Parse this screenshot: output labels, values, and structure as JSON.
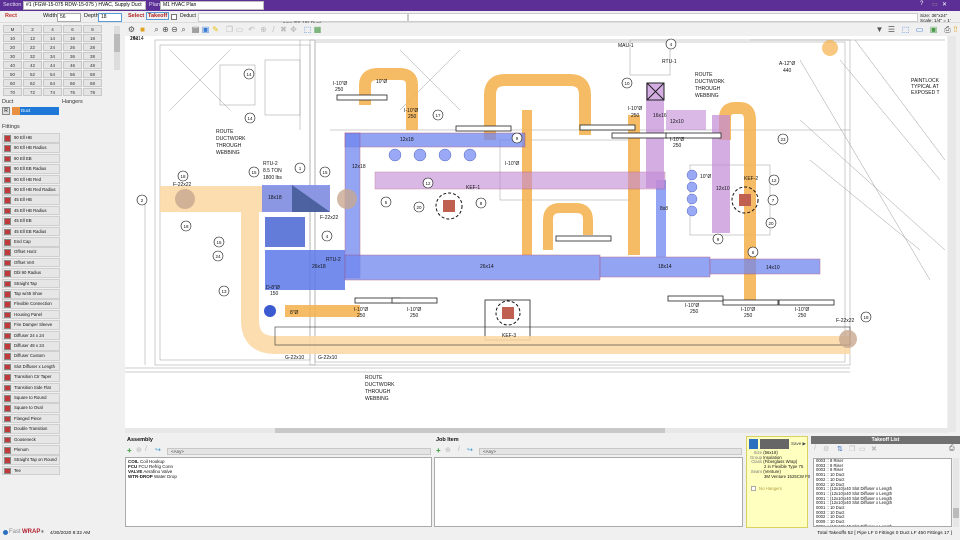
{
  "titlebar": {
    "section_label": "Section",
    "section_value": "#1 (FGW-15-075 RDW-15-075 ) HVAC, Supply Duct",
    "plan_label": "Plan",
    "plan_value": "M1  HVAC Plan",
    "help": "?",
    "restore": "▭",
    "close": "✕"
  },
  "toolbar": {
    "shape": "Rect",
    "width_label": "Width",
    "width_value": "56",
    "depth_label": "Depth",
    "depth_value": "18",
    "select": "Select",
    "takeoff": "Takeoff",
    "deduct": "Deduct",
    "insert_hint": "Insert new (56,18) Duct...",
    "size_scale": "Size: 36\"x24\"  Scale: 1/4\" = 1'"
  },
  "size_grid": [
    [
      "M",
      "2",
      "4",
      "6",
      "8"
    ],
    [
      "10",
      "12",
      "14",
      "16",
      "18"
    ],
    [
      "20",
      "22",
      "24",
      "26",
      "28"
    ],
    [
      "30",
      "32",
      "34",
      "36",
      "38"
    ],
    [
      "40",
      "42",
      "44",
      "46",
      "48"
    ],
    [
      "50",
      "52",
      "54",
      "56",
      "58"
    ],
    [
      "60",
      "62",
      "64",
      "66",
      "68"
    ],
    [
      "70",
      "72",
      "74",
      "76",
      "78"
    ]
  ],
  "duct": {
    "label": "Duct",
    "hangers_label": "Hangers",
    "r_btn": "R",
    "selected": "Duct"
  },
  "fittings": {
    "label": "Fittings",
    "items": [
      "90 Ell HB",
      "90 Ell HB Radius",
      "90 Ell EB",
      "90 Ell EB Radius",
      "90 Ell HB Red",
      "90 Ell HB Red Radius",
      "45 Ell HB",
      "45 Ell HB Radius",
      "45 Ell EB",
      "45 Ell EB Radius",
      "End Cap",
      "Offset Horiz",
      "Offset Vert",
      "Dbl 90 Radius",
      "Straight Tap",
      "Tap w/45 Shoe",
      "Flexible Connection",
      "Housing Panel",
      "Fire Damper Sleeve",
      "Diffuser 24 x 24",
      "Diffuser 48 x 24",
      "Diffuser Custom",
      "Slot Diffuser x Length",
      "Transition Ctr Taper",
      "Transition Side Flat",
      "Square to Round",
      "Square to Oval",
      "Flanged Piece",
      "Double Transition",
      "Gooseneck",
      "Plenum",
      "Straight Tap on Round",
      "Tee"
    ]
  },
  "drawing": {
    "labels": [
      "ROUTE",
      "DUCTWORK",
      "THROUGH",
      "WEBBING",
      "RTU-2",
      "8.5 TON",
      "1800 lbs",
      "18x18",
      "F-22x22",
      "F-22x22",
      "I-10\"Ø",
      "250",
      "10\"Ø",
      "12x18",
      "12x18",
      "KEF-1",
      "MAU-1",
      "RTU-1",
      "I-10\"Ø",
      "250",
      "I-10\"Ø",
      "250",
      "16x16",
      "12x10",
      "I-10\"Ø",
      "250",
      "ROUTE",
      "DUCTWORK",
      "THROUGH",
      "WEBBING",
      "A-12\"Ø",
      "440",
      "PAINTLOCK",
      "TYPICAL AT",
      "EXPOSED T",
      "KEF-2",
      "12x10",
      "10\"Ø",
      "26x14",
      "18x14",
      "14x10",
      "RTU-2",
      "26x18",
      "D-8\"Ø",
      "150",
      "8\"Ø",
      "G-22x10",
      "G-22x10",
      "ROUTE",
      "DUCTWORK",
      "THROUGH",
      "WEBBING",
      "I-10\"Ø",
      "250",
      "I-10\"Ø",
      "250",
      "KEF-3",
      "I-10\"Ø",
      "250",
      "I-10\"Ø",
      "250",
      "I-10\"Ø",
      "250",
      "F-22x22",
      "8x8",
      "I-10\"Ø",
      "250",
      "14x14"
    ],
    "callouts": [
      "14",
      "14",
      "2",
      "15",
      "1",
      "15",
      "18",
      "18",
      "15",
      "24",
      "4",
      "13",
      "17",
      "12",
      "8",
      "20",
      "5",
      "9",
      "4",
      "10",
      "23",
      "12",
      "7",
      "20",
      "9",
      "6",
      "18"
    ]
  },
  "assembly": {
    "title": "Assembly",
    "filter": "<Any>",
    "items": [
      {
        "code": "COIL",
        "desc": "Coil Hookup"
      },
      {
        "code": "FCU",
        "desc": "FCU Refrig Conn"
      },
      {
        "code": "VALVE",
        "desc": "Aerafino Valve"
      },
      {
        "code": "WTR-DROP",
        "desc": "Water Drop"
      }
    ]
  },
  "job_item": {
    "title": "Job Item",
    "filter": "<Any>"
  },
  "properties": {
    "save": "Save ▶",
    "size_label": "Size",
    "size": "(56x18)",
    "group_label": "Group",
    "group": "Insulation",
    "class_label": "Class",
    "class": "(Fiberglass Wrap)",
    "class2": "2 in Flexible Type  75",
    "seam_label": "Seam",
    "seam": "(Venture)",
    "seam2": "3M Venture 1525CW FSK",
    "no_hangers": "No Hangers"
  },
  "takeoff_list": {
    "title": "Takeoff List",
    "items": [
      "0003 :: 8 Riser",
      "0003 :: 8 Riser",
      "0003 :: 8 Riser",
      "0001 :: 10 Duct",
      "0002 :: 10 Duct",
      "0002 :: 10 Duct",
      "0001 :: (12x10)x40 Slot Diffuser x Length",
      "0001 :: (12x10)x40 Slot Diffuser x Length",
      "0001 :: (12x10)x40 Slot Diffuser x Length",
      "0001 :: (12x10)x40 Slot Diffuser x Length",
      "0001 :: 10 Duct",
      "0003 :: 10 Duct",
      "0002 :: 10 Duct",
      "0009 :: 10 Duct",
      "0001 :: (12x10)x40 Slot Diffuser x Length"
    ]
  },
  "status": {
    "brand_fast": "Fast",
    "brand_wrap": "WRAP",
    "brand_tm": "®",
    "datetime": "4/30/2020 8:32 AM",
    "totals": "Total Takeoffs 52   [ Pipe LF 0  Fittings 0  Duct LF 450  Fittings 17 ]"
  },
  "colors": {
    "title": "#5b2f96",
    "duct_blue": "#6f86f0",
    "duct_orange": "#f5b04a",
    "duct_purple": "#c28ad6",
    "fitting_red": "#c0393b"
  }
}
